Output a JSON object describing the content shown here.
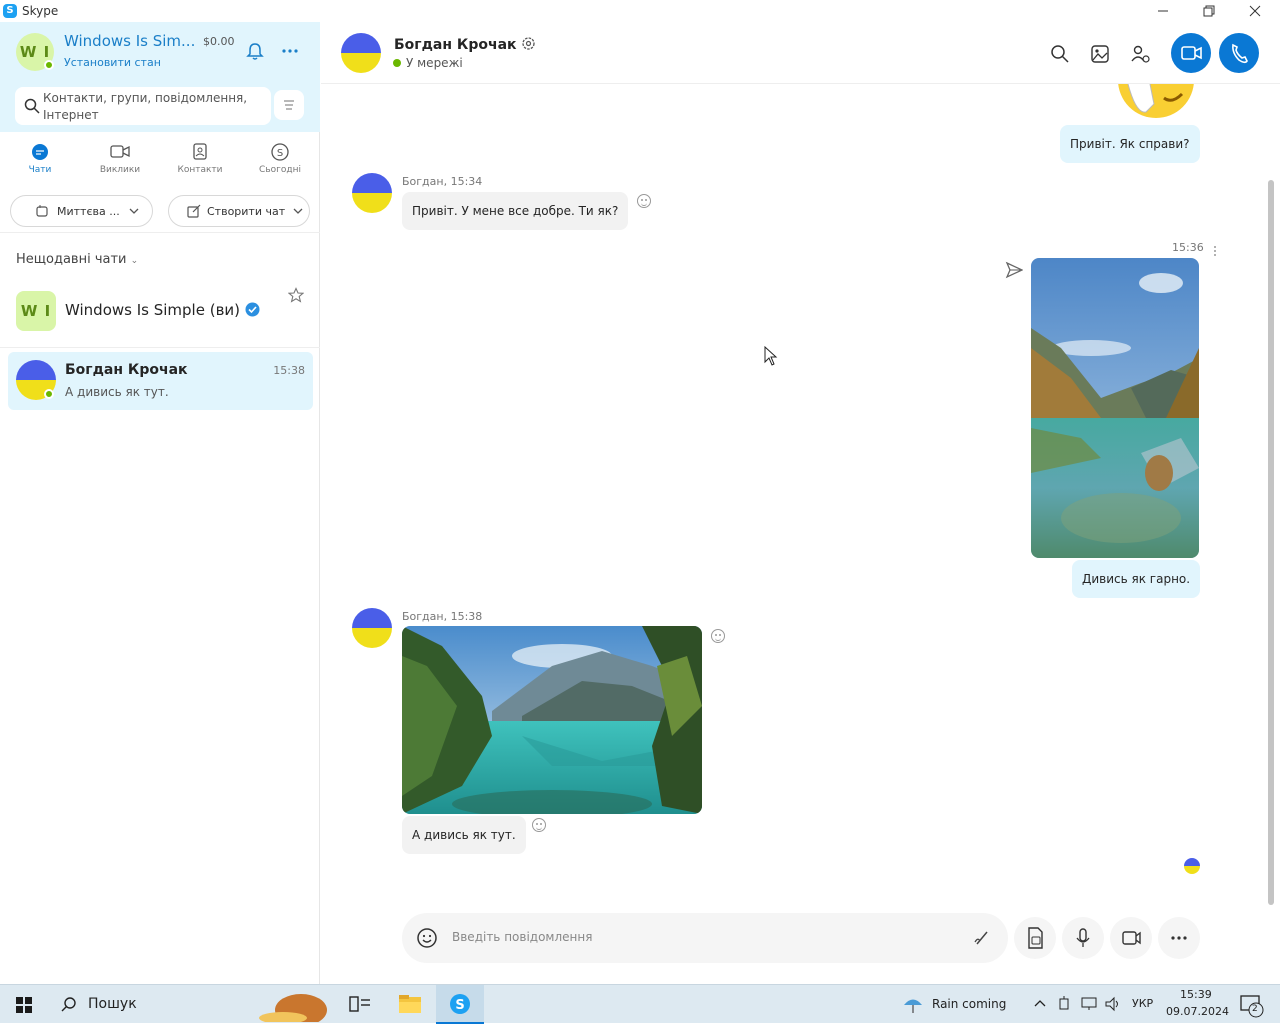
{
  "window": {
    "title": "Skype"
  },
  "profile": {
    "initials": "W I",
    "name": "Windows Is Sim...",
    "balance": "$0.00",
    "set_status": "Установити стан"
  },
  "search": {
    "placeholder_line1": "Контакти, групи, повідомлення,",
    "placeholder_line2": "Інтернет"
  },
  "nav": {
    "tabs": [
      {
        "label": "Чати",
        "icon": "chat-icon"
      },
      {
        "label": "Виклики",
        "icon": "video-call-icon"
      },
      {
        "label": "Контакти",
        "icon": "contacts-icon"
      },
      {
        "label": "Сьогодні",
        "icon": "skype-today-icon"
      }
    ]
  },
  "actions": {
    "meet_now": "Миттєва ...",
    "new_chat": "Створити чат"
  },
  "recent": {
    "label": "Нещодавні чати",
    "chats": [
      {
        "initials": "W I",
        "name": "Windows Is Simple (ви)",
        "verified": true
      },
      {
        "name": "Богдан Крочак",
        "preview": "А дивись як тут.",
        "time": "15:38",
        "selected": true
      }
    ]
  },
  "conversation": {
    "contact_name": "Богдан Крочак",
    "status": "У мережі",
    "messages": [
      {
        "direction": "out",
        "text": "Привіт. Як справи?"
      },
      {
        "direction": "in",
        "meta": "Богдан, 15:34",
        "text": "Привіт. У мене все добре. Ти як?"
      },
      {
        "direction": "out",
        "time": "15:36",
        "caption": "Дивись як гарно.",
        "type": "image"
      },
      {
        "direction": "in",
        "meta": "Богдан, 15:38",
        "caption": "А дивись як тут.",
        "type": "image"
      }
    ],
    "composer_placeholder": "Введіть повідомлення"
  },
  "taskbar": {
    "search_label": "Пошук",
    "weather": "Rain coming",
    "language": "УКР",
    "time": "15:39",
    "date": "09.07.2024",
    "notifications": "2"
  },
  "colors": {
    "accent": "#0a78d4",
    "sidebar_top": "#e1f5fd",
    "outgoing_bubble": "#e1f5fd",
    "incoming_bubble": "#f2f2f2",
    "link": "#1b7fc8"
  }
}
